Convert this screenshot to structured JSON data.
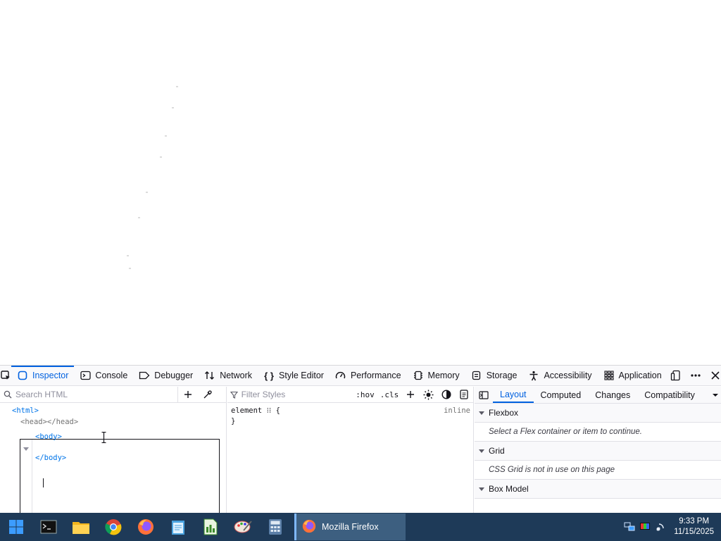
{
  "devtools": {
    "tabs": [
      {
        "label": "Inspector",
        "icon": "inspector-icon",
        "active": true
      },
      {
        "label": "Console",
        "icon": "console-icon"
      },
      {
        "label": "Debugger",
        "icon": "debugger-icon"
      },
      {
        "label": "Network",
        "icon": "network-icon"
      },
      {
        "label": "Style Editor",
        "icon": "style-editor-icon"
      },
      {
        "label": "Performance",
        "icon": "performance-icon"
      },
      {
        "label": "Memory",
        "icon": "memory-icon"
      },
      {
        "label": "Storage",
        "icon": "storage-icon"
      },
      {
        "label": "Accessibility",
        "icon": "accessibility-icon"
      },
      {
        "label": "Application",
        "icon": "application-icon"
      }
    ],
    "markup": {
      "search_placeholder": "Search HTML",
      "html_open": "<html>",
      "head_line": "<head></head>",
      "body_open": "<body>",
      "body_close": "</body>"
    },
    "rules": {
      "filter_placeholder": "Filter Styles",
      "hov": ":hov",
      "cls": ".cls",
      "rule_selector": "element ⁝⁝ {",
      "rule_close": "}",
      "rule_source": "inline"
    },
    "sidebar": {
      "tabs": [
        "Layout",
        "Computed",
        "Changes",
        "Compatibility"
      ],
      "active_tab": "Layout",
      "sections": {
        "flexbox_title": "Flexbox",
        "flexbox_msg": "Select a Flex container or item to continue.",
        "grid_title": "Grid",
        "grid_msg": "CSS Grid is not in use on this page",
        "boxmodel_title": "Box Model"
      }
    }
  },
  "taskbar": {
    "active_window": "Mozilla Firefox",
    "time": "9:33 PM",
    "date": "11/15/2025"
  },
  "colors": {
    "accent": "#0061e0",
    "taskbar": "#1e3a58"
  }
}
